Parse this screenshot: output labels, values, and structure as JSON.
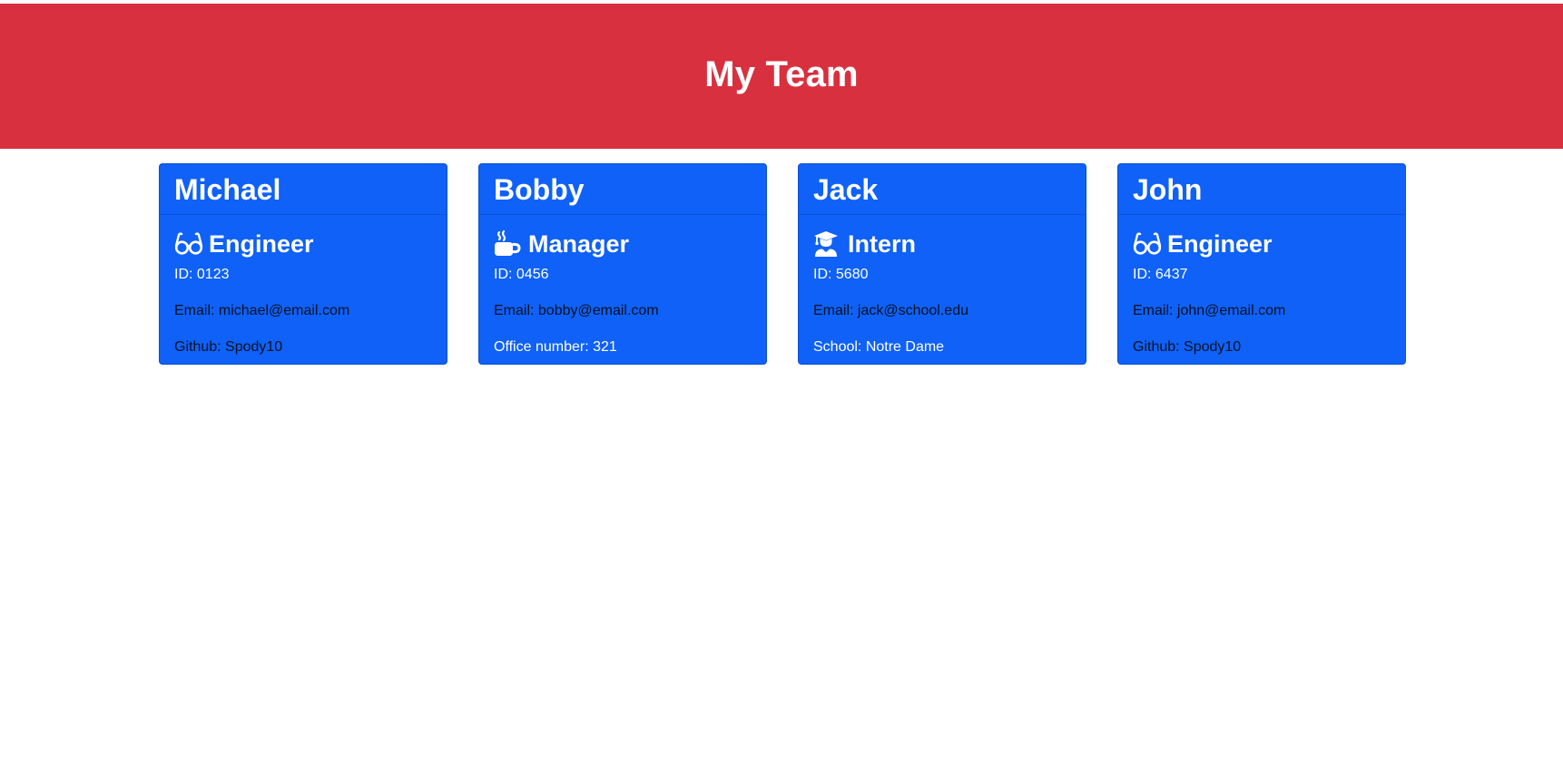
{
  "header": {
    "title": "My Team"
  },
  "colors": {
    "banner": "#d8303f",
    "card": "#0f61f7"
  },
  "team": [
    {
      "name": "Michael",
      "role": "Engineer",
      "icon": "glasses-icon",
      "id": "ID: 0123",
      "email": "Email: michael@email.com",
      "extra": "Github: Spody10"
    },
    {
      "name": "Bobby",
      "role": "Manager",
      "icon": "coffee-icon",
      "id": "ID: 0456",
      "email": "Email: bobby@email.com",
      "extra": "Office number: 321"
    },
    {
      "name": "Jack",
      "role": "Intern",
      "icon": "graduate-icon",
      "id": "ID: 5680",
      "email": "Email: jack@school.edu",
      "extra": "School: Notre Dame"
    },
    {
      "name": "John",
      "role": "Engineer",
      "icon": "glasses-icon",
      "id": "ID: 6437",
      "email": "Email: john@email.com",
      "extra": "Github: Spody10"
    }
  ]
}
